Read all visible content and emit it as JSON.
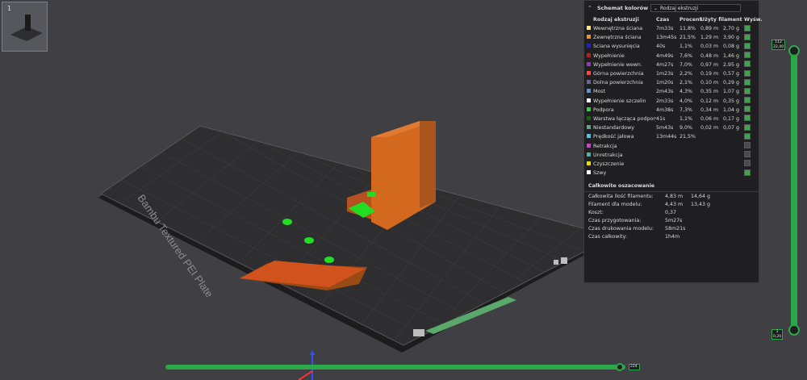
{
  "thumbnail": {
    "plate_number": "1"
  },
  "plate": {
    "label": "Bambu Textured PEI Plate"
  },
  "legend": {
    "title": "Schemat kolorów",
    "dropdown_value": "Rodzaj ekstruzji",
    "headers": [
      "Rodzaj ekstruzji",
      "Czas",
      "Procent",
      "Użyty filament",
      "Wyśw."
    ],
    "rows": [
      {
        "name": "Wewnętrzna ściana",
        "time": "7m33s",
        "pct": "11,8%",
        "fl": "0,89 m",
        "fg": "2,70 g",
        "color": "#ffe680",
        "visible": true
      },
      {
        "name": "Zewnętrzna ściana",
        "time": "13m45s",
        "pct": "21,5%",
        "fl": "1,29 m",
        "fg": "3,90 g",
        "color": "#ff8c19",
        "visible": true
      },
      {
        "name": "Ściana wysunięcia",
        "time": "40s",
        "pct": "1,1%",
        "fl": "0,03 m",
        "fg": "0,08 g",
        "color": "#2222cc",
        "visible": true
      },
      {
        "name": "Wypełnienie",
        "time": "4m49s",
        "pct": "7,6%",
        "fl": "0,48 m",
        "fg": "1,46 g",
        "color": "#b02222",
        "visible": true
      },
      {
        "name": "Wypełnienie wewn.",
        "time": "4m27s",
        "pct": "7,0%",
        "fl": "0,97 m",
        "fg": "2,95 g",
        "color": "#9933cc",
        "visible": true
      },
      {
        "name": "Górna powierzchnia",
        "time": "1m23s",
        "pct": "2,2%",
        "fl": "0,19 m",
        "fg": "0,57 g",
        "color": "#ff4444",
        "visible": true
      },
      {
        "name": "Dolna powierzchnia",
        "time": "1m20s",
        "pct": "2,1%",
        "fl": "0,10 m",
        "fg": "0,29 g",
        "color": "#6666aa",
        "visible": true
      },
      {
        "name": "Most",
        "time": "2m43s",
        "pct": "4,3%",
        "fl": "0,35 m",
        "fg": "1,07 g",
        "color": "#5f8fcf",
        "visible": true
      },
      {
        "name": "Wypełnienie szczelin",
        "time": "2m33s",
        "pct": "4,0%",
        "fl": "0,12 m",
        "fg": "0,35 g",
        "color": "#ffffff",
        "visible": true
      },
      {
        "name": "Podpora",
        "time": "4m38s",
        "pct": "7,3%",
        "fl": "0,34 m",
        "fg": "1,04 g",
        "color": "#22dd22",
        "visible": true
      },
      {
        "name": "Warstwa łącząca podpory",
        "time": "41s",
        "pct": "1,1%",
        "fl": "0,06 m",
        "fg": "0,17 g",
        "color": "#116611",
        "visible": true
      },
      {
        "name": "Niestandardowy",
        "time": "5m43s",
        "pct": "9,0%",
        "fl": "0,02 m",
        "fg": "0,07 g",
        "color": "#55aa88",
        "visible": true
      },
      {
        "name": "Prędkość jałowa",
        "time": "13m44s",
        "pct": "21,5%",
        "fl": "",
        "fg": "",
        "color": "#52c0e0",
        "visible": true
      },
      {
        "name": "Retrakcja",
        "time": "",
        "pct": "",
        "fl": "",
        "fg": "",
        "color": "#cc44cc",
        "visible": false
      },
      {
        "name": "Unretrakcja",
        "time": "",
        "pct": "",
        "fl": "",
        "fg": "",
        "color": "#4ab0b0",
        "visible": false
      },
      {
        "name": "Czyszczenie",
        "time": "",
        "pct": "",
        "fl": "",
        "fg": "",
        "color": "#e0e000",
        "visible": false
      },
      {
        "name": "Szwy",
        "time": "",
        "pct": "",
        "fl": "",
        "fg": "",
        "color": "#ffffff",
        "visible": true
      }
    ]
  },
  "summary": {
    "title": "Całkowite oszacowanie",
    "rows": [
      {
        "label": "Całkowita ilość filamentu:",
        "v1": "4,83 m",
        "v2": "14,64 g"
      },
      {
        "label": "Filament dla modelu:",
        "v1": "4,43 m",
        "v2": "13,43 g"
      },
      {
        "label": "Koszt:",
        "v1": "0,37",
        "v2": ""
      },
      {
        "label": "Czas przygotowania:",
        "v1": "5m27s",
        "v2": ""
      },
      {
        "label": "Czas drukowania modelu:",
        "v1": "58m21s",
        "v2": ""
      },
      {
        "label": "Czas całkowity:",
        "v1": "1h4m",
        "v2": ""
      }
    ]
  },
  "layer_slider": {
    "top_value": "112",
    "top_height": "22,40",
    "bottom_value": "1",
    "bottom_height": "0,20"
  },
  "move_slider": {
    "value": "224"
  },
  "colors": {
    "accent": "#2aa84a",
    "panel": "#1f1f21",
    "background": "#3f3f44",
    "model": "#d2691e",
    "plate": "#2f2f31"
  }
}
